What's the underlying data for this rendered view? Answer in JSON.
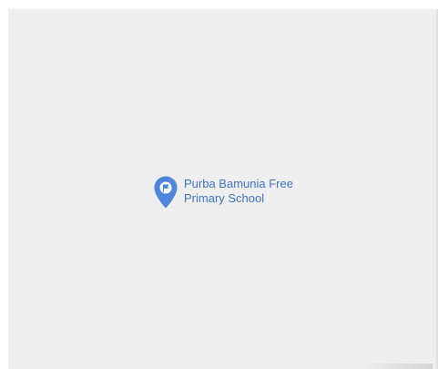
{
  "map": {
    "background_color": "#efefef",
    "marker": {
      "icon": "map-pin-icon",
      "color": "#4d86db",
      "label_line_1": "Purba Bamunia Free",
      "label_line_2": "Primary School"
    }
  }
}
